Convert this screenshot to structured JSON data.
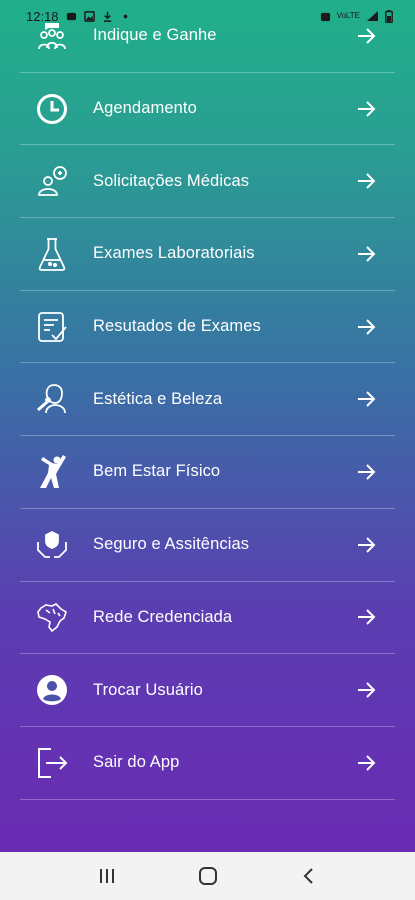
{
  "status_bar": {
    "time": "12:18",
    "left_icons": [
      "notification-icon",
      "image-icon",
      "download-icon",
      "dot-icon"
    ],
    "right_icons": [
      "alarm-icon",
      "volte-icon",
      "signal-icon",
      "battery-icon"
    ],
    "network_text": "VoLTE"
  },
  "menu": {
    "items": [
      {
        "label": "Indique e Ganhe",
        "icon": "people-group-icon"
      },
      {
        "label": "Agendamento",
        "icon": "clock-icon"
      },
      {
        "label": "Solicitações Médicas",
        "icon": "doctor-chat-icon"
      },
      {
        "label": "Exames Laboratoriais",
        "icon": "flask-icon"
      },
      {
        "label": "Resutados de Exames",
        "icon": "clipboard-check-icon"
      },
      {
        "label": "Estética e Beleza",
        "icon": "beauty-face-icon"
      },
      {
        "label": "Bem Estar Físico",
        "icon": "stretching-person-icon"
      },
      {
        "label": "Seguro e Assitências",
        "icon": "hands-shield-icon"
      },
      {
        "label": "Rede Credenciada",
        "icon": "brazil-map-icon"
      },
      {
        "label": "Trocar Usuário",
        "icon": "user-circle-icon"
      },
      {
        "label": "Sair do App",
        "icon": "logout-icon"
      }
    ]
  },
  "nav_bar": {
    "buttons": [
      "recent-apps-icon",
      "home-icon",
      "back-icon"
    ]
  },
  "colors": {
    "gradient_top": "#20b089",
    "gradient_bottom": "#6a2bb3",
    "text": "#ffffff",
    "nav_background": "#f3f3f3"
  }
}
